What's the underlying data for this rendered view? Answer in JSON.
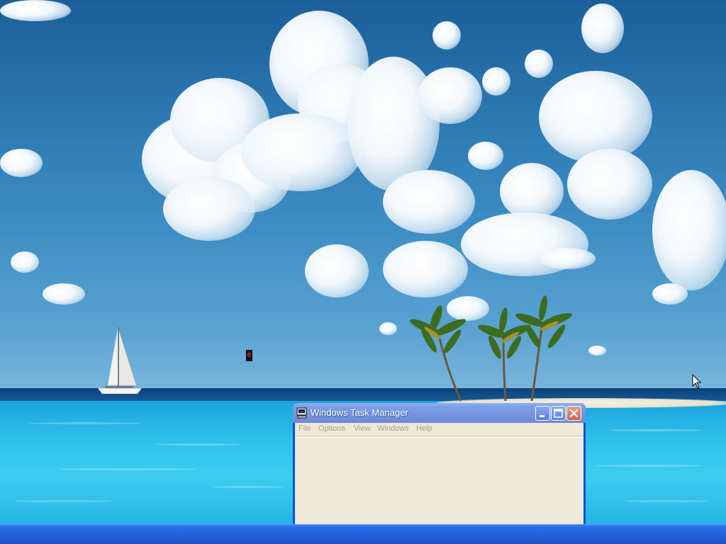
{
  "desktop": {
    "marker_text": "0"
  },
  "window": {
    "title": "Windows Task Manager",
    "title_icon": "computer-icon",
    "menu": [
      {
        "label": "File"
      },
      {
        "label": "Options"
      },
      {
        "label": "View"
      },
      {
        "label": "Windows"
      },
      {
        "label": "Help"
      }
    ],
    "menu_disabled": true,
    "controls": [
      "minimize-icon",
      "maximize-icon",
      "close-icon"
    ]
  },
  "colors": {
    "title_bar": "#7593e0",
    "client_background": "#ece9d8",
    "taskbar": "#245edb",
    "close_button": "#d0654a"
  }
}
